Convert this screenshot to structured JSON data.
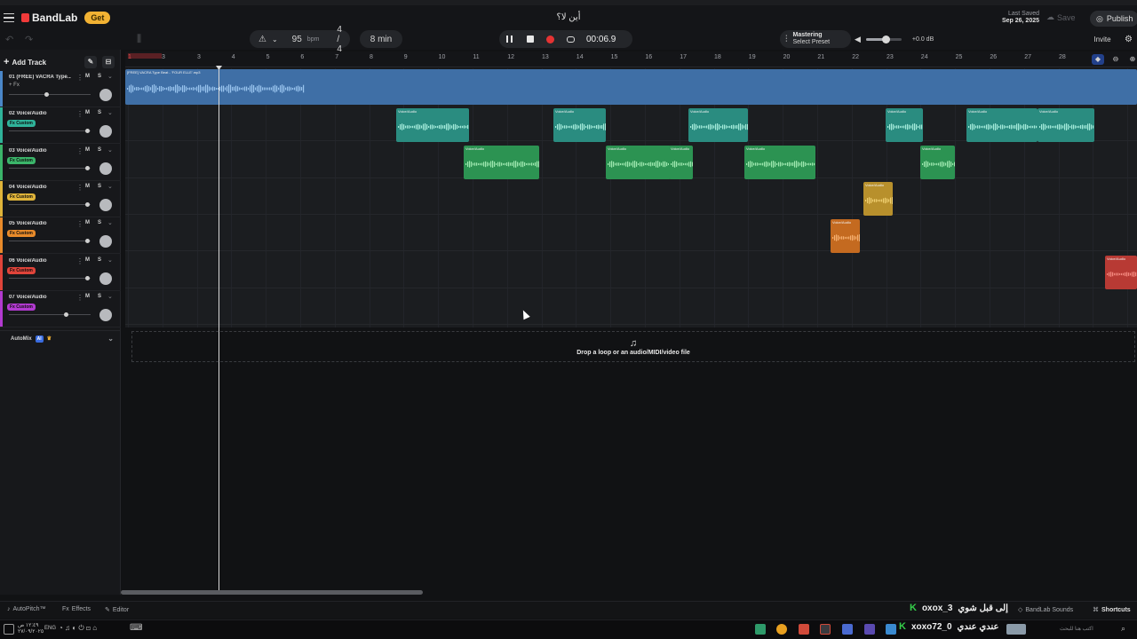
{
  "app": {
    "logo": "BandLab",
    "get_button": "Get",
    "project_title": "أين لا؟",
    "last_saved_label": "Last Saved",
    "last_saved_date": "Sep 26, 2025",
    "save_label": "Save",
    "publish_label": "Publish"
  },
  "toolbar": {
    "tempo": "95",
    "bpm_label": "bpm",
    "time_signature": "4 / 4",
    "length": "8 min",
    "timecode": "00:06.9",
    "mastering_label": "Mastering",
    "mastering_preset": "Select Preset",
    "master_volume_db": "+0.0 dB",
    "master_volume_level": 0.55,
    "invite_label": "Invite"
  },
  "tracks_panel": {
    "add_track_label": "Add Track",
    "automix_label": "AutoMix",
    "automix_badge": "AI"
  },
  "tracks": [
    {
      "name": "01 (FREE) VACRA Type...",
      "fx": "+ Fx",
      "color": "#4a86c8",
      "fx_color": "",
      "volume": 0.45
    },
    {
      "name": "02 Voice/Audio",
      "fx": "Fx Custom",
      "color": "#2fb39a",
      "fx_color": "#2fb39a",
      "volume": 0.98
    },
    {
      "name": "03 Voice/Audio",
      "fx": "Fx Custom",
      "color": "#3bb56a",
      "fx_color": "#3bb56a",
      "volume": 0.98
    },
    {
      "name": "04 Voice/Audio",
      "fx": "Fx Custom",
      "color": "#e0b43a",
      "fx_color": "#e0b43a",
      "volume": 0.98
    },
    {
      "name": "05 Voice/Audio",
      "fx": "Fx Custom",
      "color": "#e88a2a",
      "fx_color": "#e88a2a",
      "volume": 0.98
    },
    {
      "name": "06 Voice/Audio",
      "fx": "Fx Custom",
      "color": "#e0443a",
      "fx_color": "#e0443a",
      "volume": 0.98
    },
    {
      "name": "07 Voice/Audio",
      "fx": "Fx Custom",
      "color": "#b23ad0",
      "fx_color": "#b23ad0",
      "volume": 0.7
    }
  ],
  "track_buttons": {
    "mute": "M",
    "solo": "S"
  },
  "ruler_numbers": [
    "1",
    "3",
    "3",
    "4",
    "5",
    "6",
    "7",
    "8",
    "9",
    "10",
    "11",
    "12",
    "13",
    "14",
    "15",
    "16",
    "17",
    "18",
    "19",
    "20",
    "21",
    "22",
    "23",
    "24",
    "25",
    "26",
    "27",
    "28"
  ],
  "beat_clip_title": "[FREE] VACRA Type Beat - 'FOUR ELLE'.mp3",
  "clip_label": "Voice/Audio",
  "dropzone_text": "Drop a loop or an audio/MIDI/video file",
  "bottom_bar": {
    "autopitch": "AutoPitch™",
    "effects": "Effects",
    "editor": "Editor",
    "sounds": "BandLab Sounds",
    "shortcuts": "Shortcuts"
  },
  "overlay": {
    "line1_user": "oxox_3",
    "line1_text": "إلى قبل شوي",
    "line2_user": "xoxo72_0",
    "line2_text": "عندي عندي"
  },
  "taskbar": {
    "time": "١٢:٤٩ ص",
    "date": "٢٧/٠٩/٢٠٢٥",
    "lang": "ENG",
    "search_placeholder": "اكتب هنا للبحث"
  }
}
